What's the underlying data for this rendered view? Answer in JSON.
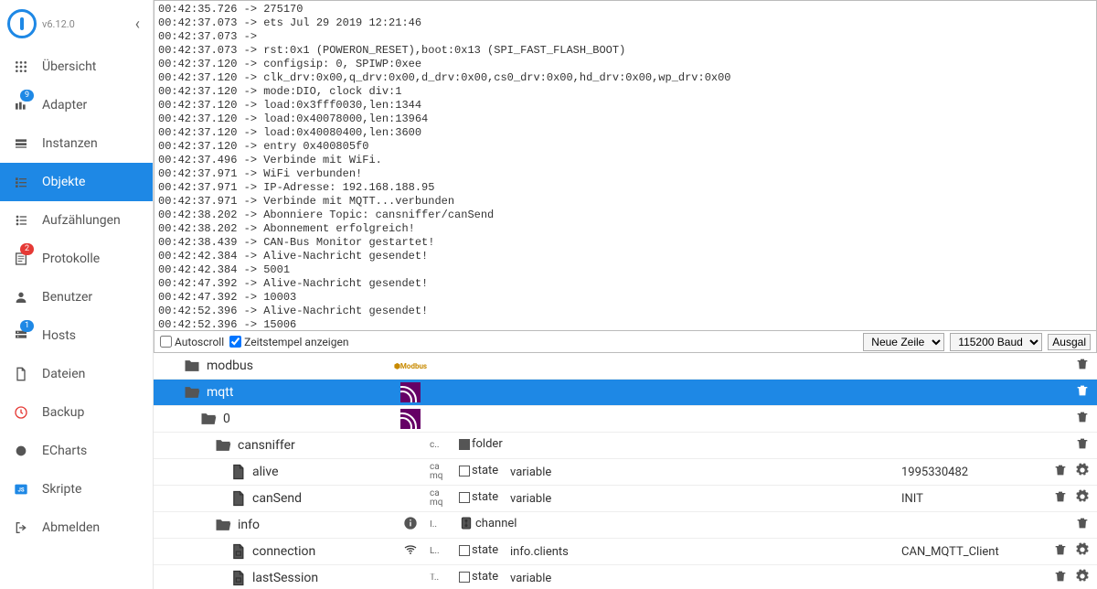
{
  "version": "v6.12.0",
  "nav": [
    {
      "id": "overview",
      "label": "Übersicht",
      "icon": "grid"
    },
    {
      "id": "adapter",
      "label": "Adapter",
      "icon": "adapter",
      "badge": "9",
      "badgeColor": "blue"
    },
    {
      "id": "instances",
      "label": "Instanzen",
      "icon": "instances"
    },
    {
      "id": "objects",
      "label": "Objekte",
      "icon": "list",
      "active": true
    },
    {
      "id": "enums",
      "label": "Aufzählungen",
      "icon": "enums"
    },
    {
      "id": "logs",
      "label": "Protokolle",
      "icon": "logs",
      "badge": "2",
      "badgeColor": "red"
    },
    {
      "id": "users",
      "label": "Benutzer",
      "icon": "user"
    },
    {
      "id": "hosts",
      "label": "Hosts",
      "icon": "hosts",
      "badge": "1",
      "badgeColor": "blue"
    },
    {
      "id": "files",
      "label": "Dateien",
      "icon": "files"
    },
    {
      "id": "backup",
      "label": "Backup",
      "icon": "backup"
    },
    {
      "id": "echarts",
      "label": "ECharts",
      "icon": "echarts"
    },
    {
      "id": "scripts",
      "label": "Skripte",
      "icon": "scripts"
    },
    {
      "id": "logout",
      "label": "Abmelden",
      "icon": "logout"
    }
  ],
  "serial": {
    "lines": [
      "00:42:35.726 -> 275170",
      "00:42:37.073 -> ets Jul 29 2019 12:21:46",
      "00:42:37.073 -> ",
      "00:42:37.073 -> rst:0x1 (POWERON_RESET),boot:0x13 (SPI_FAST_FLASH_BOOT)",
      "00:42:37.120 -> configsip: 0, SPIWP:0xee",
      "00:42:37.120 -> clk_drv:0x00,q_drv:0x00,d_drv:0x00,cs0_drv:0x00,hd_drv:0x00,wp_drv:0x00",
      "00:42:37.120 -> mode:DIO, clock div:1",
      "00:42:37.120 -> load:0x3fff0030,len:1344",
      "00:42:37.120 -> load:0x40078000,len:13964",
      "00:42:37.120 -> load:0x40080400,len:3600",
      "00:42:37.120 -> entry 0x400805f0",
      "00:42:37.496 -> Verbinde mit WiFi.",
      "00:42:37.971 -> WiFi verbunden!",
      "00:42:37.971 -> IP-Adresse: 192.168.188.95",
      "00:42:37.971 -> Verbinde mit MQTT...verbunden",
      "00:42:38.202 -> Abonniere Topic: cansniffer/canSend",
      "00:42:38.202 -> Abonnement erfolgreich!",
      "00:42:38.439 -> CAN-Bus Monitor gestartet!",
      "00:42:42.384 -> Alive-Nachricht gesendet!",
      "00:42:42.384 -> 5001",
      "00:42:47.392 -> Alive-Nachricht gesendet!",
      "00:42:47.392 -> 10003",
      "00:42:52.396 -> Alive-Nachricht gesendet!",
      "00:42:52.396 -> 15006"
    ],
    "autoscroll_label": "Autoscroll",
    "timestamp_label": "Zeitstempel anzeigen",
    "timestamp_checked": true,
    "line_ending": "Neue Zeile",
    "baud": "115200 Baud",
    "output_btn": "Ausgal"
  },
  "tree": [
    {
      "depth": 0,
      "name": "modbus",
      "icon": "folder",
      "adapterLogo": "modbus",
      "actions": [
        "trash"
      ]
    },
    {
      "depth": 0,
      "name": "mqtt",
      "icon": "folder-open",
      "adapterLogo": "mqtt",
      "selected": true,
      "actions": [
        "trash"
      ]
    },
    {
      "depth": 1,
      "name": "0",
      "icon": "folder-open",
      "adapterLogo": "mqtt",
      "actions": [
        "trash"
      ]
    },
    {
      "depth": 2,
      "name": "cansniffer",
      "icon": "folder-open",
      "adapt": "c..",
      "roleIcon": "folder-filled",
      "role": "folder",
      "type": "",
      "actions": [
        "trash"
      ]
    },
    {
      "depth": 3,
      "name": "alive",
      "icon": "file",
      "adapt": "ca\nmq",
      "roleIcon": "state",
      "role": "state",
      "type": "variable",
      "value": "1995330482",
      "actions": [
        "trash",
        "gear"
      ]
    },
    {
      "depth": 3,
      "name": "canSend",
      "icon": "file",
      "adapt": "ca\nmq",
      "roleIcon": "state",
      "role": "state",
      "type": "variable",
      "value": "INIT",
      "actions": [
        "trash",
        "gear"
      ]
    },
    {
      "depth": 2,
      "name": "info",
      "icon": "folder-open",
      "adapt": "",
      "adaptIcon": "info",
      "roleIcon": "channel",
      "role": "channel",
      "type": "",
      "adaptText": "I..",
      "actions": [
        "trash"
      ]
    },
    {
      "depth": 3,
      "name": "connection",
      "icon": "file-box",
      "adapt": "",
      "adaptIcon": "wifi",
      "adaptText": "L..",
      "roleIcon": "state",
      "role": "state",
      "type": "info.clients",
      "value": "CAN_MQTT_Client",
      "actions": [
        "trash",
        "gear"
      ]
    },
    {
      "depth": 3,
      "name": "lastSession",
      "icon": "file-box",
      "adapt": "T..",
      "roleIcon": "state",
      "role": "state",
      "type": "variable",
      "actions": [
        "trash",
        "gear"
      ]
    }
  ]
}
